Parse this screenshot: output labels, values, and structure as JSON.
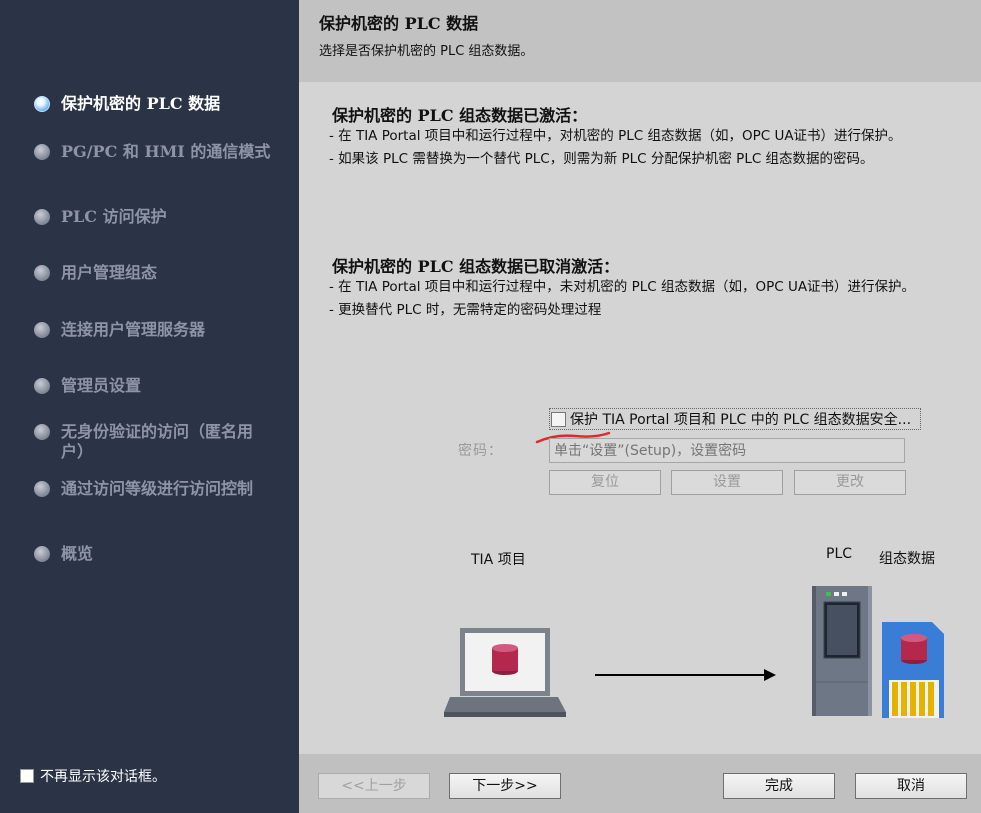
{
  "sidebar": {
    "steps": [
      {
        "label": "保护机密的 PLC 数据"
      },
      {
        "label": "PG/PC 和 HMI 的通信模式"
      },
      {
        "label": "PLC 访问保护"
      },
      {
        "label": "用户管理组态"
      },
      {
        "label": "连接用户管理服务器"
      },
      {
        "label": "管理员设置"
      },
      {
        "label": "无身份验证的访问（匿名用户）"
      },
      {
        "label": "通过访问等级进行访问控制"
      },
      {
        "label": "概览"
      }
    ],
    "active_step": 0,
    "dont_show_label": "不再显示该对话框。"
  },
  "header": {
    "title": "保护机密的 PLC 数据",
    "subtitle": "选择是否保护机密的 PLC 组态数据。"
  },
  "content": {
    "active_section": {
      "title": "保护机密的 PLC 组态数据已激活：",
      "line1": "- 在 TIA Portal 项目中和运行过程中，对机密的 PLC 组态数据（如，OPC UA证书）进行保护。",
      "line2": "- 如果该 PLC 需替换为一个替代 PLC，则需为新 PLC 分配保护机密 PLC 组态数据的密码。"
    },
    "inactive_section": {
      "title": "保护机密的 PLC 组态数据已取消激活：",
      "line1": "- 在 TIA Portal 项目中和运行过程中，未对机密的 PLC 组态数据（如，OPC UA证书）进行保护。",
      "line2": "- 更换替代 PLC 时，无需特定的密码处理过程"
    },
    "protect_checkbox_label": "保护 TIA Portal 项目和 PLC 中的 PLC 组态数据安全...",
    "protect_checked": false,
    "password_label": "密码：",
    "password_placeholder": "单击“设置”(Setup)，设置密码",
    "buttons": {
      "reset": "复位",
      "set": "设置",
      "change": "更改"
    },
    "diagram": {
      "tia_label": "TIA 项目",
      "plc_label": "PLC",
      "config_label": "组态数据"
    }
  },
  "footer": {
    "prev": "<<上一步",
    "next": "下一步>>",
    "finish": "完成",
    "cancel": "取消"
  },
  "colors": {
    "sidebar_bg": "#2b3346",
    "header_bg": "#c2c2c2",
    "content_bg": "#d4d4d4",
    "db_red": "#b5284e"
  }
}
